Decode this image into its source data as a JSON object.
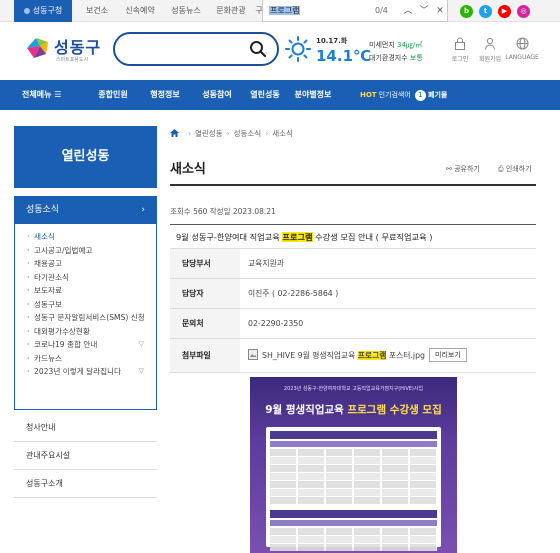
{
  "top_tabs": [
    "성동구청",
    "보건소",
    "신속예약",
    "성동뉴스",
    "문화관광",
    "구석"
  ],
  "find": {
    "query": "프로그램",
    "count": "0/4"
  },
  "sns": [
    "b",
    "t",
    "▶",
    "◎"
  ],
  "colors": {
    "primary": "#1a5fb4",
    "highlight": "#ffea00",
    "temp": "#1b7fd6",
    "dust_good": "#1b9e4b"
  },
  "header": {
    "logo_name": "성동구",
    "logo_sub": "스마트포용도시",
    "search_placeholder": "",
    "weather": {
      "date": "10.17.화",
      "temp": "14.1℃",
      "dust_label": "미세먼지",
      "dust_value": "34㎍/㎥",
      "air_label": "대기환경지수",
      "air_value": "보통"
    },
    "util": [
      {
        "label": "로그인",
        "icon": "lock-icon"
      },
      {
        "label": "회원가입",
        "icon": "user-icon"
      },
      {
        "label": "LANGUAGE",
        "icon": "globe-icon"
      }
    ]
  },
  "gnb": {
    "all": "전체메뉴",
    "items": [
      "종합민원",
      "행정정보",
      "성동참여",
      "열린성동",
      "분야별정보"
    ],
    "hot_label": "HOT",
    "hot_text": "인기검색어",
    "hot_rank": "1",
    "hot_word": "폐기물"
  },
  "sidebar": {
    "title": "열린성동",
    "category": "성동소식",
    "items": [
      {
        "label": "새소식",
        "active": true,
        "sub": ""
      },
      {
        "label": "고시공고/입법예고",
        "active": false,
        "sub": ""
      },
      {
        "label": "채용공고",
        "active": false,
        "sub": ""
      },
      {
        "label": "타기관소식",
        "active": false,
        "sub": ""
      },
      {
        "label": "보도자료",
        "active": false,
        "sub": ""
      },
      {
        "label": "성동구보",
        "active": false,
        "sub": ""
      },
      {
        "label": "성동구 문자알림서비스(SMS) 신청",
        "active": false,
        "sub": ""
      },
      {
        "label": "대외평가수상현황",
        "active": false,
        "sub": ""
      },
      {
        "label": "코로나19 종합 안내",
        "active": false,
        "sub": "▽"
      },
      {
        "label": "카드뉴스",
        "active": false,
        "sub": ""
      },
      {
        "label": "2023년 이렇게 달라집니다",
        "active": false,
        "sub": "▽"
      }
    ],
    "menus": [
      "청사안내",
      "관내주요시설",
      "성동구소개"
    ]
  },
  "content": {
    "breadcrumb": [
      "열린성동",
      "성동소식",
      "새소식"
    ],
    "title": "새소식",
    "share": "공유하기",
    "print": "인쇄하기",
    "views": "조회수 560 작성일 2023.08.21",
    "post_title_pre": "9월 성동구-한양여대 직업교육 ",
    "post_title_hl": "프로그램",
    "post_title_post": " 수강생 모집 안내 ( 무료직업교육 )",
    "rows": [
      {
        "th": "담당부서",
        "td": "교육지원과"
      },
      {
        "th": "담당자",
        "td": "이진주 ( 02-2286-5864 )"
      },
      {
        "th": "문의처",
        "td": "02-2290-2350"
      }
    ],
    "file": {
      "th": "첨부파일",
      "pre": "SH_HIVE 9월 평생직업교육 ",
      "hl": "프로그램",
      "post": " 포스터.jpg",
      "preview": "미리보기"
    },
    "poster": {
      "top": "2023년 성동구-한양여자대학교 고등직업교육거점지구(HiVE)사업",
      "title_white": "9월 평생직업교육 ",
      "title_yellow": "프로그램 수강생 모집"
    }
  }
}
